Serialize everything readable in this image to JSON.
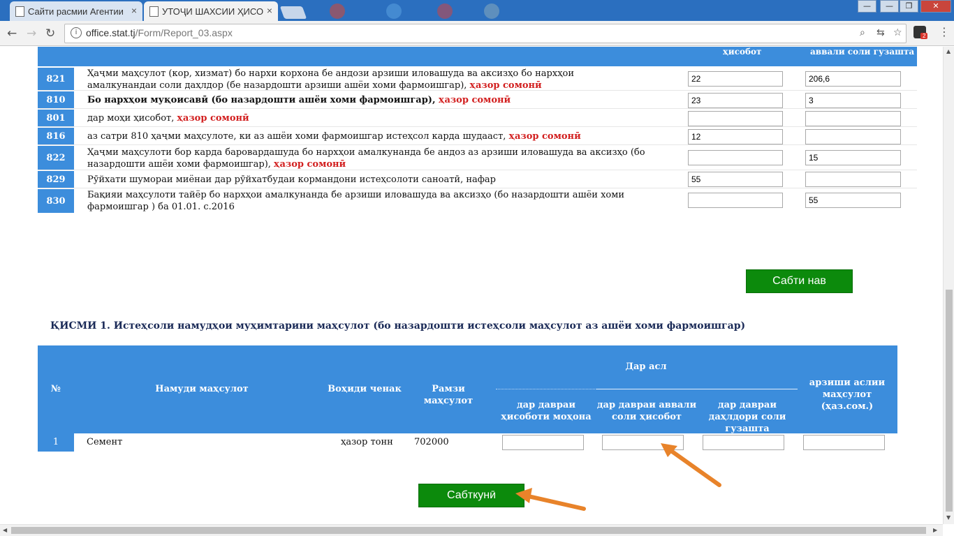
{
  "browser": {
    "tabs": [
      {
        "label": "Сайти расмии Агентии"
      },
      {
        "label": "УТОҶИ ШАХСИИ ҲИСО"
      }
    ],
    "url_host": "office.stat.tj",
    "url_path": "/Form/Report_03.aspx",
    "extension_count": "2",
    "window_controls": {
      "minimize": "—",
      "maximize": "❐",
      "close": "✕"
    },
    "nav": {
      "back": "←",
      "forward": "→",
      "reload": "↻"
    }
  },
  "table1": {
    "header_col_a": "ҳисобот",
    "header_col_b": "аввали соли гузашта",
    "rows": [
      {
        "code": "821",
        "desc": "Ҳаҷми маҳсулот (кор, хизмат) бо нархи корхона бе андози арзиши иловашуда ва аксизҳо бо нархҳои амалкунандаи соли даҳлдор (бе назардошти арзиши ашёи хоми фармоишгар),",
        "unit": "ҳазор сомонӣ",
        "val_a": "22",
        "val_b": "206,6"
      },
      {
        "code": "810",
        "desc": "Бо нархҳои муқоисавӣ (бо назардошти ашёи хоми фармоишгар),",
        "unit": "ҳазор сомонӣ",
        "val_a": "23",
        "val_b": "3"
      },
      {
        "code": "801",
        "desc": "дар моҳи ҳисобот,",
        "unit": "ҳазор сомонӣ",
        "val_a": "",
        "val_b": ""
      },
      {
        "code": "816",
        "desc": "аз сатри 810 ҳаҷми маҳсулоте, ки аз ашёи хоми фармоишгар истеҳсол карда шудааст,",
        "unit": "ҳазор сомонӣ",
        "val_a": "12",
        "val_b": ""
      },
      {
        "code": "822",
        "desc": "Ҳаҷми маҳсулоти бор карда баровардашуда бо нархҳои амалкунанда бе андоз аз арзиши иловашуда ва аксизҳо (бо назардошти ашёи хоми фармоишгар),",
        "unit": "ҳазор сомонӣ",
        "val_a": "",
        "val_b": "15"
      },
      {
        "code": "829",
        "desc": "Рӯйхати шумораи миёнаи дар рӯйхатбудаи кормандони истеҳсолоти саноатӣ, нафар",
        "unit": "",
        "val_a": "55",
        "val_b": ""
      },
      {
        "code": "830",
        "desc": "Бақияи маҳсулоти тайёр бо нархҳои амалкунанда бе арзиши иловашуда ва аксизҳо (бо назардошти ашёи хоми фармоишгар ) ба 01.01. с.2016",
        "unit": "",
        "val_a": "",
        "val_b": "55"
      }
    ]
  },
  "buttons": {
    "save_new": "Сабти нав",
    "save_today": "Сабткунӣ"
  },
  "section_title": "ҚИСМИ 1. Истеҳсоли намудҳои муҳимтарини маҳсулот (бо назардошти истеҳсоли маҳсулот аз ашёи хоми фармоишгар)",
  "table2": {
    "headers": {
      "num": "№",
      "product_type": "Намуди маҳсулот",
      "unit": "Воҳиди ченак",
      "code": "Рамзи маҳсулот",
      "group": "Дар асл",
      "col_period": "дар давраи ҳисоботи моҳона",
      "col_prev": "дар давраи аввали соли ҳисобот",
      "col_last_year": "дар давраи даҳлдори соли гузашта",
      "col_value": "арзиши аслии маҳсулот (ҳаз.сом.)"
    },
    "row": {
      "num": "1",
      "product": "Семент",
      "unit": "ҳазор тонн",
      "code": "702000",
      "period": "",
      "prev": "",
      "last_year": "",
      "value": ""
    }
  },
  "colors": {
    "header_blue": "#3c8ddc",
    "button_green": "#0c8a0c",
    "unit_red": "#d21f1f",
    "annotation_arrow": "#e8832a"
  }
}
